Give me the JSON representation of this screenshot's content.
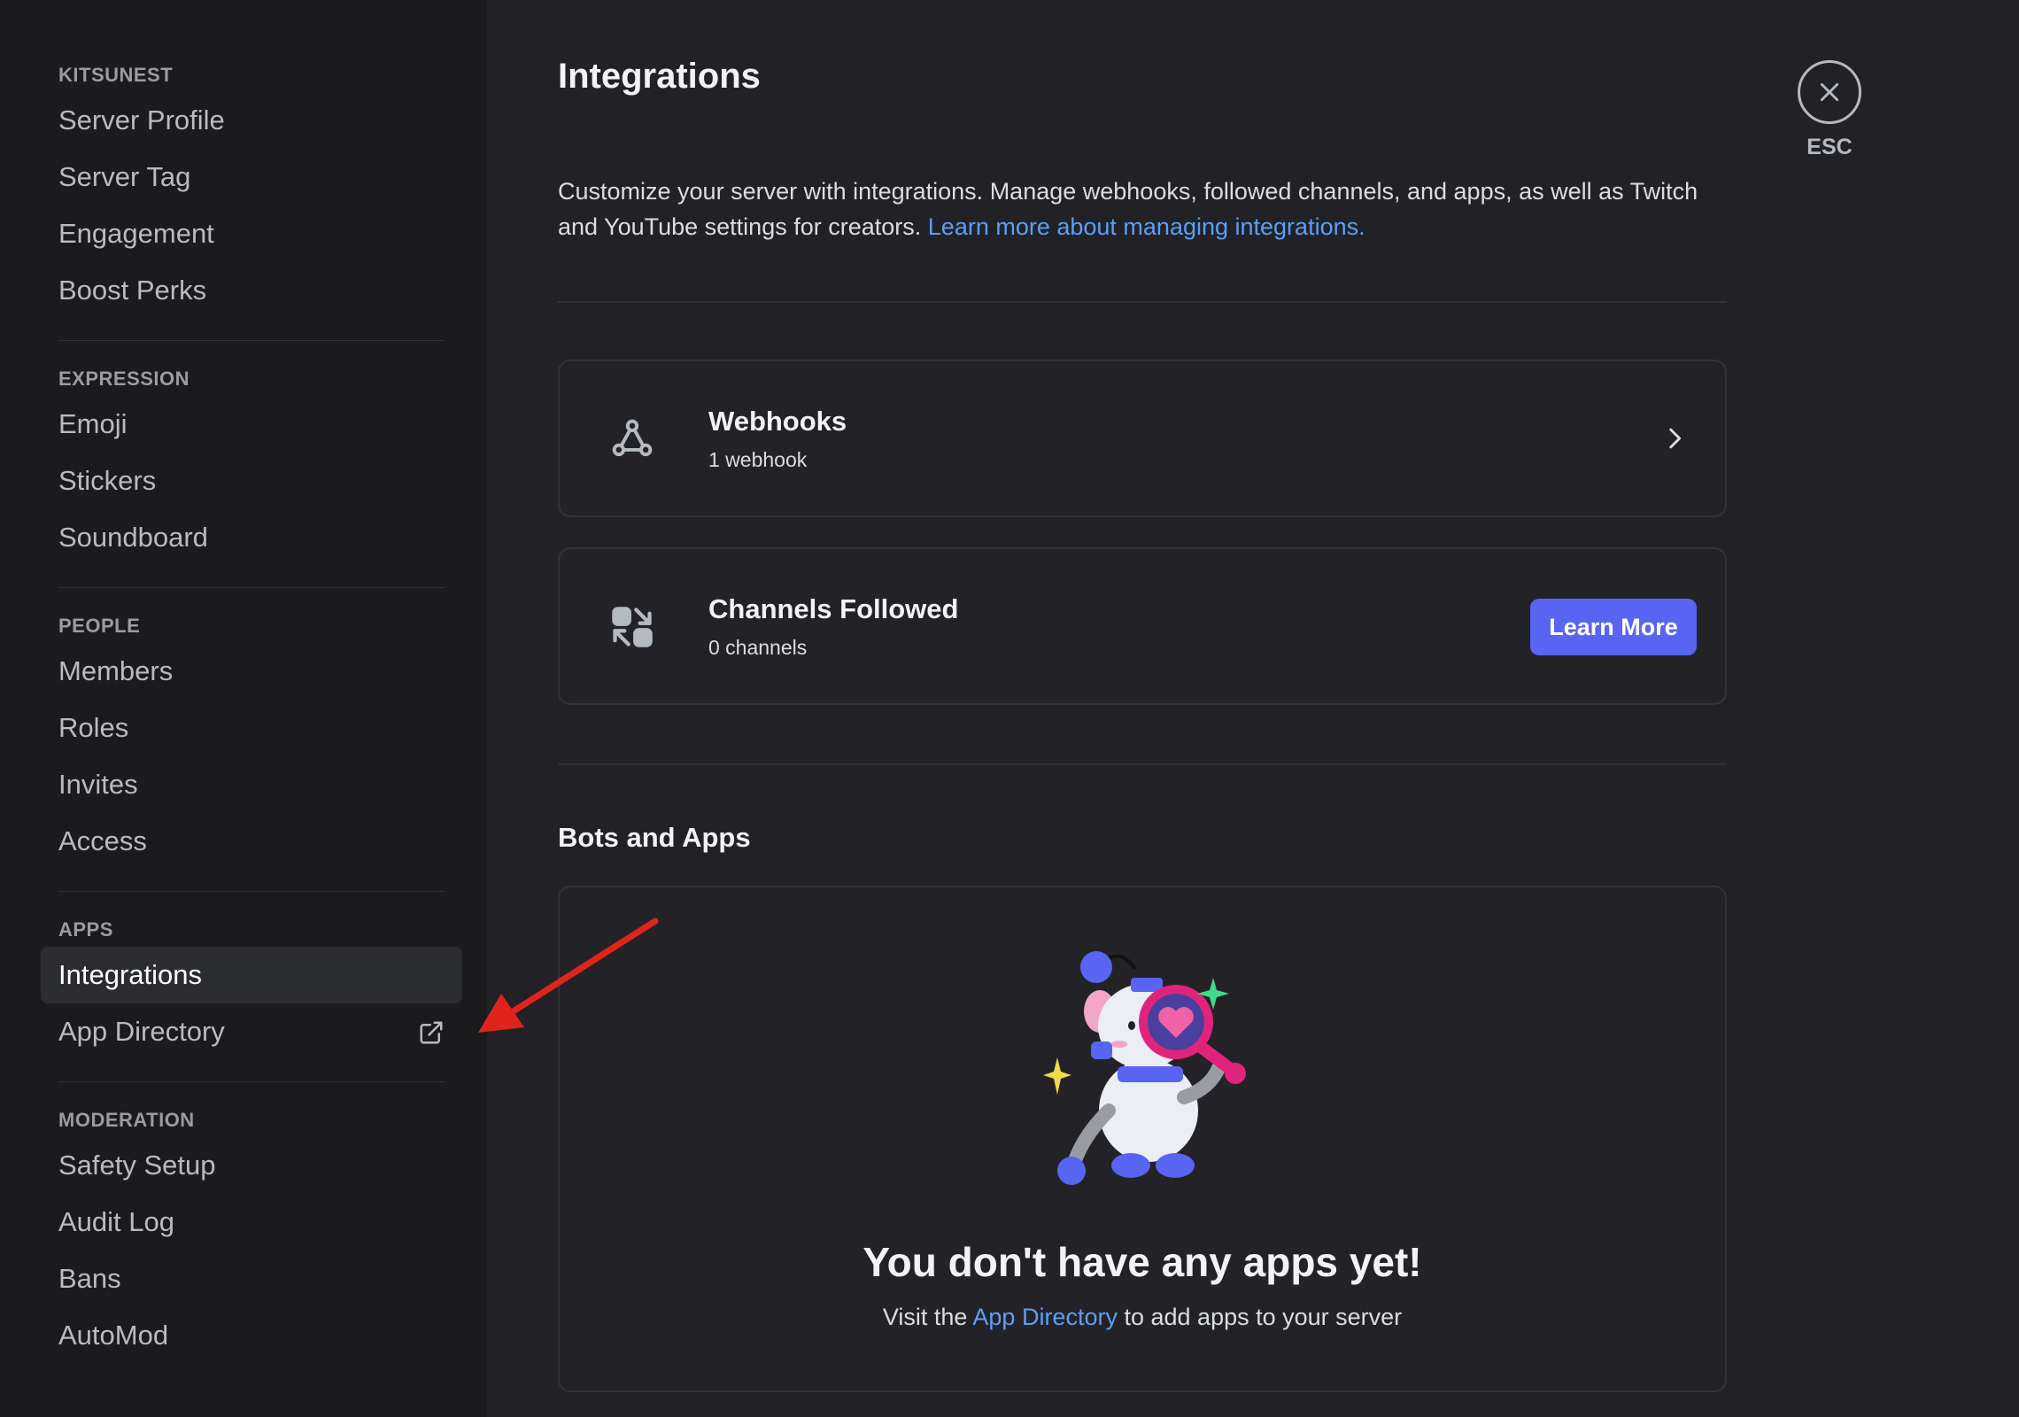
{
  "sidebar": {
    "sections": [
      {
        "header": "KITSUNEST",
        "items": [
          "Server Profile",
          "Server Tag",
          "Engagement",
          "Boost Perks"
        ]
      },
      {
        "header": "EXPRESSION",
        "items": [
          "Emoji",
          "Stickers",
          "Soundboard"
        ]
      },
      {
        "header": "PEOPLE",
        "items": [
          "Members",
          "Roles",
          "Invites",
          "Access"
        ]
      },
      {
        "header": "APPS",
        "items": [
          "Integrations",
          "App Directory"
        ]
      },
      {
        "header": "MODERATION",
        "items": [
          "Safety Setup",
          "Audit Log",
          "Bans",
          "AutoMod"
        ]
      }
    ],
    "active_item": "Integrations",
    "external_icon": "external-link-icon"
  },
  "main": {
    "title": "Integrations",
    "intro": "Customize your server with integrations. Manage webhooks, followed channels, and apps, as well as Twitch and YouTube settings for creators.",
    "intro_link": "Learn more about managing integrations.",
    "webhooks": {
      "title": "Webhooks",
      "sub": "1 webhook",
      "icon": "webhook-icon",
      "chevron": "chevron-right-icon"
    },
    "channels": {
      "title": "Channels Followed",
      "sub": "0 channels",
      "icon": "channels-followed-icon",
      "button": "Learn More"
    },
    "bots_title": "Bots and Apps",
    "empty_title": "You don't have any apps yet!",
    "empty_prefix": "Visit the",
    "empty_link": "App Directory",
    "empty_suffix": "to add apps to your server"
  },
  "close": {
    "icon": "close-icon",
    "label": "ESC"
  },
  "colors": {
    "background": "#222226",
    "sidebar": "#1b1b1e",
    "accent": "#5865f2",
    "link": "#5b9ff7",
    "annotation": "#e0241b"
  }
}
